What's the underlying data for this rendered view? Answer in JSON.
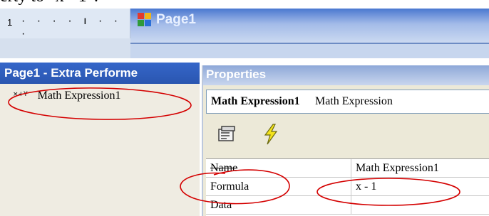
{
  "document": {
    "partial_text": "erty to \"x - 1\":"
  },
  "ruler": {
    "number": "1",
    "ticks": "· · · · ı · · ·"
  },
  "page_window": {
    "title": "Page1"
  },
  "left_panel": {
    "title": "Page1 - Extra Performe",
    "items": [
      {
        "icon_text": "×+Y",
        "label": "Math Expression1"
      }
    ]
  },
  "properties": {
    "title": "Properties",
    "selected_object": {
      "name": "Math Expression1",
      "type": "Math Expression"
    },
    "toolbar": {
      "properties_icon": "property-pages-icon",
      "events_icon": "lightning-events-icon"
    },
    "rows": [
      {
        "name": "Name",
        "value": "Math Expression1"
      },
      {
        "name": "Formula",
        "value": "x - 1"
      },
      {
        "name": "Data",
        "value": ""
      }
    ]
  },
  "colors": {
    "annotation_red": "#d40000",
    "title_blue": "#2a56b0",
    "panel_beige": "#ece9d8"
  }
}
